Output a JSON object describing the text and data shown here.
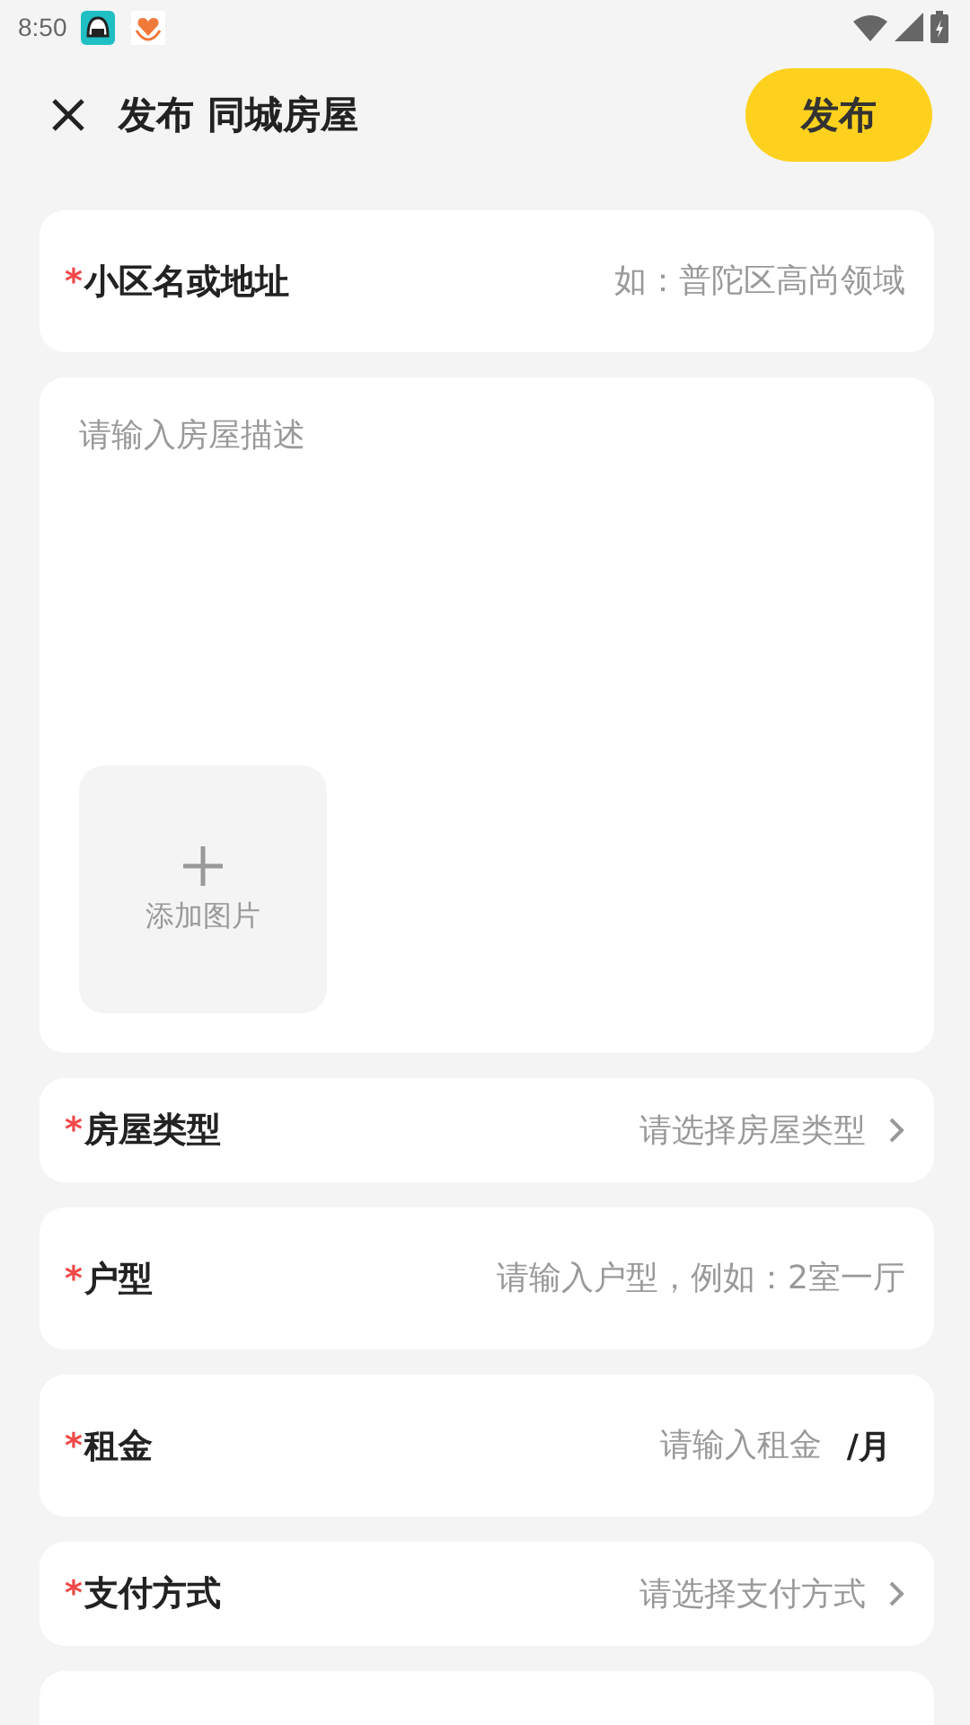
{
  "status_bar": {
    "time": "8:50"
  },
  "header": {
    "title": "发布 同城房屋",
    "publish_button": "发布"
  },
  "address": {
    "required_mark": "*",
    "label": "小区名或地址",
    "placeholder": "如：普陀区高尚领域"
  },
  "description": {
    "placeholder": "请输入房屋描述",
    "add_photo": {
      "label": "添加图片"
    }
  },
  "fields": [
    {
      "kind": "select",
      "required_mark": "*",
      "label": "房屋类型",
      "placeholder": "请选择房屋类型"
    },
    {
      "kind": "input",
      "required_mark": "*",
      "label": "户型",
      "placeholder": "请输入户型，例如：2室一厅"
    },
    {
      "kind": "unit",
      "required_mark": "*",
      "label": "租金",
      "placeholder": "请输入租金",
      "unit": "/月"
    },
    {
      "kind": "select",
      "required_mark": "*",
      "label": "支付方式",
      "placeholder": "请选择支付方式"
    }
  ]
}
